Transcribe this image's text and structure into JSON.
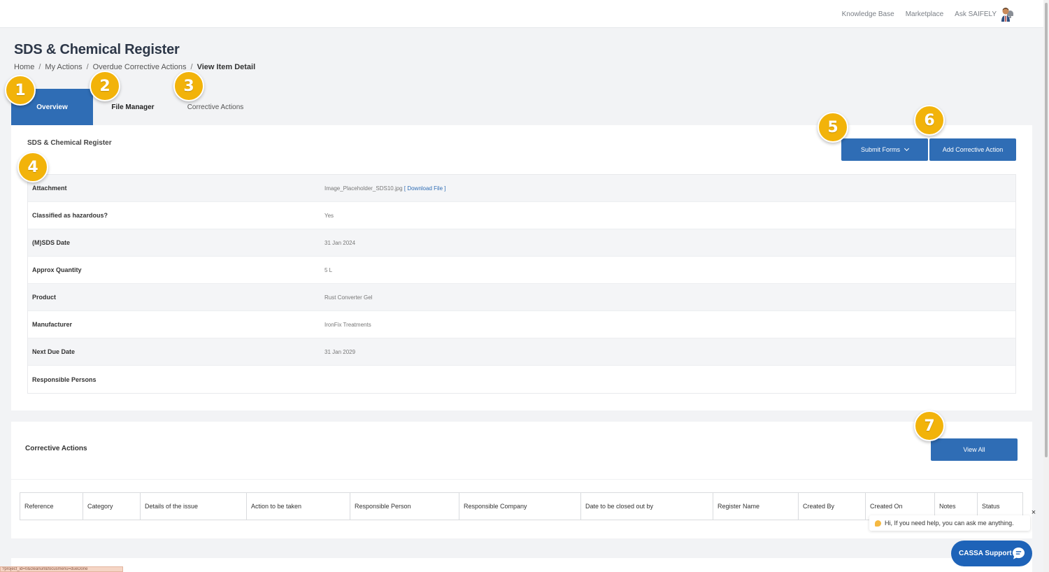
{
  "topbar": {
    "links": [
      "Knowledge Base",
      "Marketplace",
      "Ask SAIFELY"
    ],
    "icons": [
      "bell-icon",
      "avatar"
    ]
  },
  "page": {
    "title": "SDS & Chemical Register",
    "breadcrumb": [
      "Home",
      "My Actions",
      "Overdue Corrective Actions",
      "View Item Detail"
    ],
    "breadcrumb_sep": "/"
  },
  "tabs": [
    {
      "label": "Overview",
      "active": true
    },
    {
      "label": "File Manager",
      "active": false
    },
    {
      "label": "Corrective Actions",
      "active": false
    }
  ],
  "badges": [
    "1",
    "2",
    "3",
    "4",
    "5",
    "6",
    "7"
  ],
  "detail": {
    "title": "SDS & Chemical Register",
    "submit_forms": "Submit Forms",
    "add_corrective_action": "Add Corrective Action",
    "rows": [
      {
        "label": "Attachment",
        "value": "Image_Placeholder_SDS10.jpg",
        "link": "[ Download File ]"
      },
      {
        "label": "Classified as hazardous?",
        "value": "Yes"
      },
      {
        "label": "(M)SDS Date",
        "value": "31 Jan 2024"
      },
      {
        "label": "Approx Quantity",
        "value": "5 L"
      },
      {
        "label": "Product",
        "value": "Rust Converter Gel"
      },
      {
        "label": "Manufacturer",
        "value": "IronFix Treatments"
      },
      {
        "label": "Next Due Date",
        "value": "31 Jan 2029"
      },
      {
        "label": "Responsible Persons",
        "value": ""
      }
    ]
  },
  "corrective_actions": {
    "title": "Corrective Actions",
    "view_all": "View All",
    "columns": [
      "Reference",
      "Category",
      "Details of the issue",
      "Action to be taken",
      "Responsible Person",
      "Responsible Company",
      "Date to be closed out by",
      "Register Name",
      "Created By",
      "Created On",
      "Notes",
      "Status"
    ]
  },
  "chat": {
    "tip": "Hi, If you need help, you can ask me anything.",
    "close": "×",
    "support_label": "CASSA Support"
  },
  "status_url": "?project_id=0&cleanurl&focusmenu=dueDone",
  "colors": {
    "primary": "#2f6db5",
    "badge": "#f2b30a",
    "support": "#1e63b8"
  }
}
